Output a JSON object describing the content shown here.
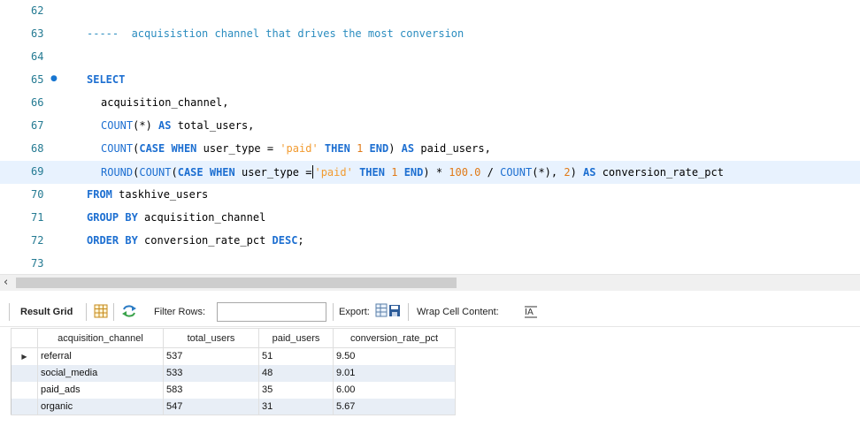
{
  "editor": {
    "lines": [
      {
        "num": "62"
      },
      {
        "num": "63",
        "comment": "-----  acquisistion channel that drives the most conversion"
      },
      {
        "num": "64"
      },
      {
        "num": "65",
        "marker": "●",
        "select_kw": "SELECT"
      },
      {
        "num": "66",
        "col": "acquisition_channel,"
      },
      {
        "num": "67",
        "fn_count": "COUNT",
        "args": "(*) ",
        "kw_as": "AS",
        "alias": " total_users,"
      },
      {
        "num": "68",
        "fn_count": "COUNT",
        "paren": "(",
        "kw_case": "CASE",
        "kw_when": "WHEN",
        "col": " user_type = ",
        "str_paid": "'paid'",
        "kw_then": "THEN",
        "num_one": "1",
        "kw_end": "END",
        "close": ") ",
        "kw_as": "AS",
        "alias": " paid_users,"
      },
      {
        "num": "69",
        "fn_round": "ROUND",
        "fn_count": "COUNT",
        "kw_case": "CASE",
        "kw_when": "WHEN",
        "col_a": " user_type ",
        "eq": "=",
        "str_paid": "'paid'",
        "kw_then": "THEN",
        "num_one": "1",
        "kw_end": "END",
        "mult": ") * ",
        "num_hundred": "100.0",
        "div": " / ",
        "fn_count2": "COUNT",
        "tail1": "(*), ",
        "num_two": "2",
        "tail2": ") ",
        "kw_as": "AS",
        "alias": " conversion_rate_pct"
      },
      {
        "num": "70",
        "kw": "FROM",
        "rest": " taskhive_users"
      },
      {
        "num": "71",
        "kw": "GROUP BY",
        "rest": " acquisition_channel"
      },
      {
        "num": "72",
        "kw": "ORDER BY",
        "rest": " conversion_rate_pct ",
        "kw2": "DESC",
        "end": ";"
      },
      {
        "num": "73"
      }
    ]
  },
  "toolbar": {
    "result_grid_label": "Result Grid",
    "filter_rows_label": "Filter Rows:",
    "filter_value": "",
    "export_label": "Export:",
    "wrap_label": "Wrap Cell Content:"
  },
  "grid": {
    "columns": [
      "acquisition_channel",
      "total_users",
      "paid_users",
      "conversion_rate_pct"
    ],
    "rows": [
      [
        "referral",
        "537",
        "51",
        "9.50"
      ],
      [
        "social_media",
        "533",
        "48",
        "9.01"
      ],
      [
        "paid_ads",
        "583",
        "35",
        "6.00"
      ],
      [
        "organic",
        "547",
        "31",
        "5.67"
      ]
    ],
    "current_row_marker": "▶"
  },
  "icons": {
    "grid_icon": "result-grid-icon",
    "refresh_icon": "refresh-icon",
    "export_icon": "export-icon",
    "wrap_icon": "wrap-cell-icon"
  },
  "colors": {
    "keyword": "#1d6fd1",
    "string": "#f29b30",
    "comment": "#2a8cbf",
    "line_number": "#247a92",
    "alt_row": "#e8eef6"
  }
}
